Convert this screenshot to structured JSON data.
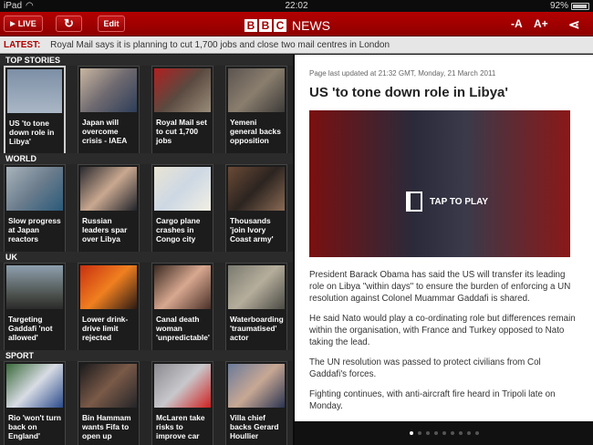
{
  "status_bar": {
    "carrier": "iPad",
    "time": "22:02",
    "battery": "92%"
  },
  "toolbar": {
    "live_label": "LIVE",
    "edit_label": "Edit",
    "logo_bbc": [
      "B",
      "B",
      "C"
    ],
    "logo_news": "NEWS",
    "font_smaller": "-A",
    "font_larger": "A+"
  },
  "ticker": {
    "label": "LATEST:",
    "text": "Royal Mail says it is planning to cut 1,700 jobs and close two mail centres in London"
  },
  "sections": [
    {
      "title": "TOP STORIES",
      "items": [
        {
          "caption": "US 'to tone down role in Libya'",
          "selected": true
        },
        {
          "caption": "Japan will overcome crisis - IAEA"
        },
        {
          "caption": "Royal Mail set to cut 1,700 jobs"
        },
        {
          "caption": "Yemeni general backs opposition"
        }
      ]
    },
    {
      "title": "WORLD",
      "items": [
        {
          "caption": "Slow progress at Japan reactors"
        },
        {
          "caption": "Russian leaders spar over Libya"
        },
        {
          "caption": "Cargo plane crashes in Congo city"
        },
        {
          "caption": "Thousands 'join Ivory Coast army'"
        }
      ]
    },
    {
      "title": "UK",
      "items": [
        {
          "caption": "Targeting Gaddafi 'not allowed'"
        },
        {
          "caption": "Lower drink-drive limit rejected"
        },
        {
          "caption": "Canal death woman 'unpredictable'"
        },
        {
          "caption": "Waterboarding 'traumatised' actor"
        }
      ]
    },
    {
      "title": "SPORT",
      "items": [
        {
          "caption": "Rio 'won't turn back on England'"
        },
        {
          "caption": "Bin Hammam wants Fifa to open up"
        },
        {
          "caption": "McLaren take risks to improve car"
        },
        {
          "caption": "Villa chief backs Gerard Houllier"
        }
      ]
    }
  ],
  "article": {
    "updated": "Page last updated at 21:32 GMT, Monday, 21 March 2011",
    "headline": "US 'to tone down role in Libya'",
    "video_label": "TAP TO PLAY",
    "paragraphs": [
      "President Barack Obama has said the US will transfer its leading role on Libya \"within days\" to ensure the burden of enforcing a UN resolution against Colonel Muammar Gaddafi is shared.",
      "He said Nato would play a co-ordinating role but differences remain within the organisation, with France and Turkey opposed to Nato taking the lead.",
      "The UN resolution was passed to protect civilians from Col Gaddafi's forces.",
      "Fighting continues, with anti-aircraft fire heard in Tripoli late on Monday."
    ]
  },
  "pager": {
    "total": 9,
    "current": 1
  }
}
